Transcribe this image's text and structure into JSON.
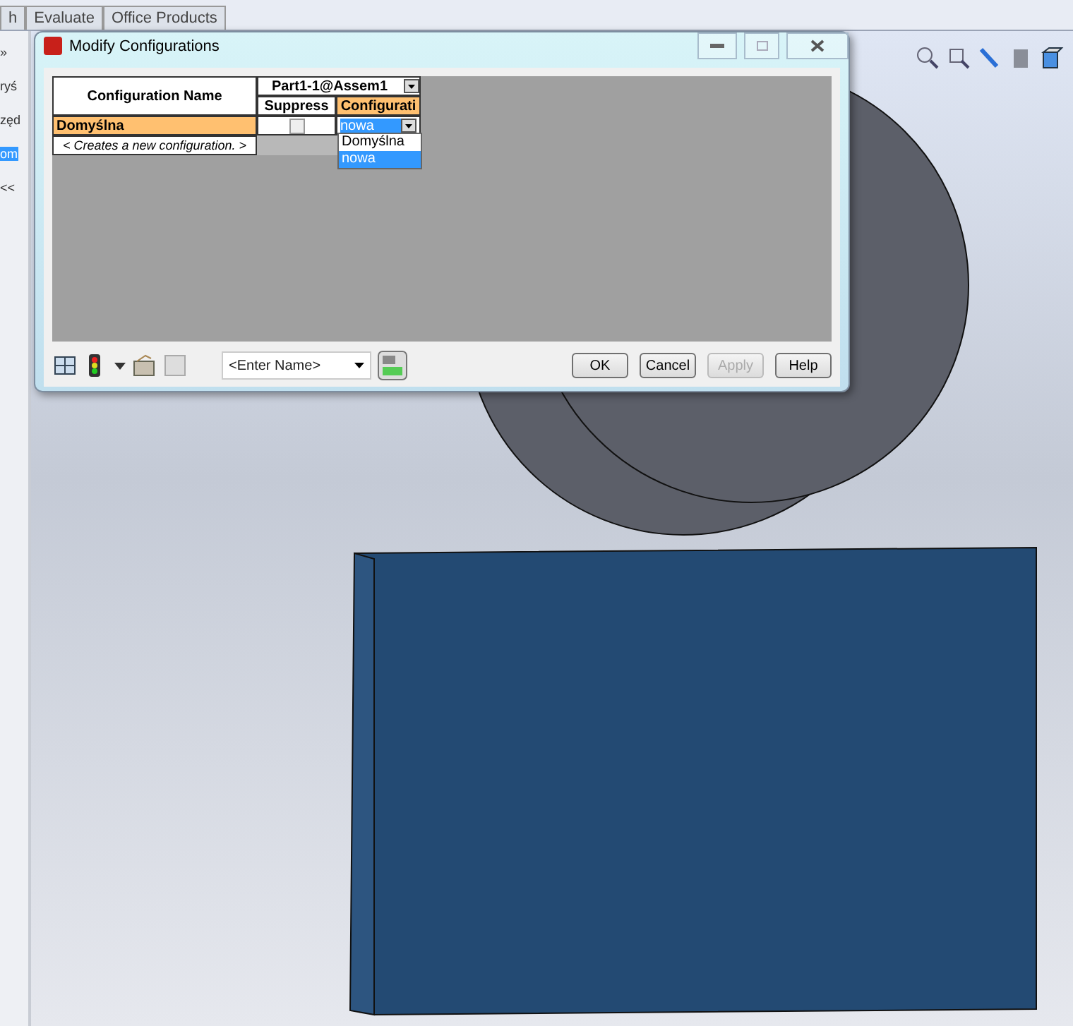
{
  "app_tabs": [
    {
      "label": "h",
      "selected": false
    },
    {
      "label": "Evaluate",
      "selected": false
    },
    {
      "label": "Office Products",
      "selected": false
    }
  ],
  "side_panel": {
    "expand": "»",
    "items": [
      {
        "text": "ryś",
        "selected": false
      },
      {
        "text": "zęd",
        "selected": false
      },
      {
        "text": "om",
        "selected": true
      },
      {
        "text": "<<",
        "selected": false
      }
    ]
  },
  "dialog": {
    "title": "Modify Configurations",
    "table": {
      "name_header": "Configuration Name",
      "component_header": "Part1-1@Assem1",
      "columns": [
        {
          "label": "Suppress",
          "selected": false
        },
        {
          "label": "Configurati",
          "selected": true
        }
      ],
      "rows": [
        {
          "name": "Domyślna",
          "selected": true,
          "suppressed": false,
          "configuration": "nowa"
        }
      ],
      "new_row": "< Creates a new configuration. >",
      "dropdown_options": [
        {
          "label": "Domyślna",
          "selected": false
        },
        {
          "label": "nowa",
          "selected": true
        }
      ]
    },
    "name_field": {
      "placeholder": "<Enter Name>"
    },
    "buttons": [
      {
        "label": "OK",
        "disabled": false
      },
      {
        "label": "Cancel",
        "disabled": false
      },
      {
        "label": "Apply",
        "disabled": true
      },
      {
        "label": "Help",
        "disabled": false
      }
    ]
  }
}
